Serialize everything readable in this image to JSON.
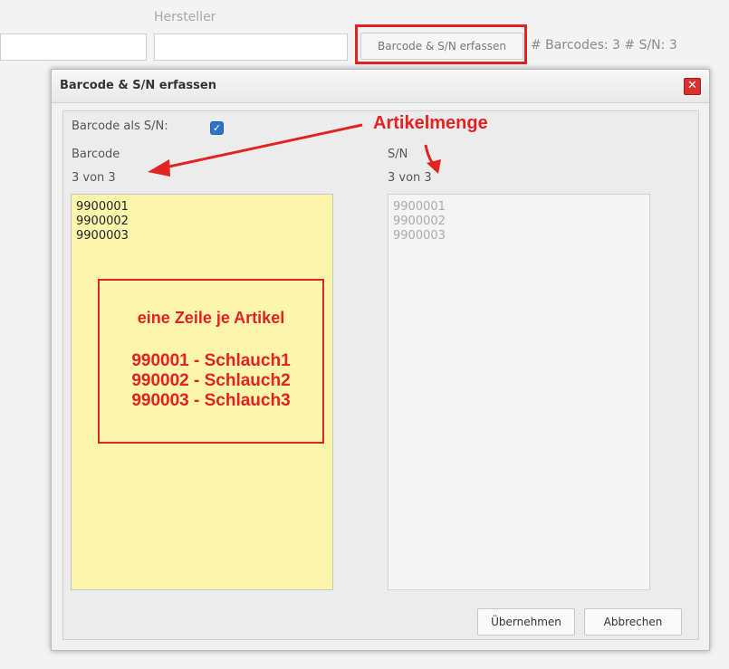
{
  "background": {
    "hersteller_label": "Hersteller",
    "barcode_button_label": "Barcode & S/N erfassen",
    "counts_text": "# Barcodes: 3 # S/N: 3"
  },
  "dialog": {
    "title": "Barcode & S/N erfassen",
    "close_glyph": "✕",
    "barcode_as_sn_label": "Barcode als S/N:",
    "barcode_as_sn_checked": true,
    "barcode_label": "Barcode",
    "barcode_count": "3 von 3",
    "sn_label": "S/N",
    "sn_count": "3 von 3",
    "barcode_text": "9900001\n9900002\n9900003",
    "sn_text": "9900001\n9900002\n9900003",
    "apply_label": "Übernehmen",
    "cancel_label": "Abbrechen"
  },
  "annotations": {
    "artikelmenge": "Artikelmenge",
    "note_title": "eine Zeile je Artikel",
    "note_lines": [
      "990001 - Schlauch1",
      "990002 - Schlauch2",
      "990003 - Schlauch3"
    ],
    "accent_color": "#e32222"
  }
}
